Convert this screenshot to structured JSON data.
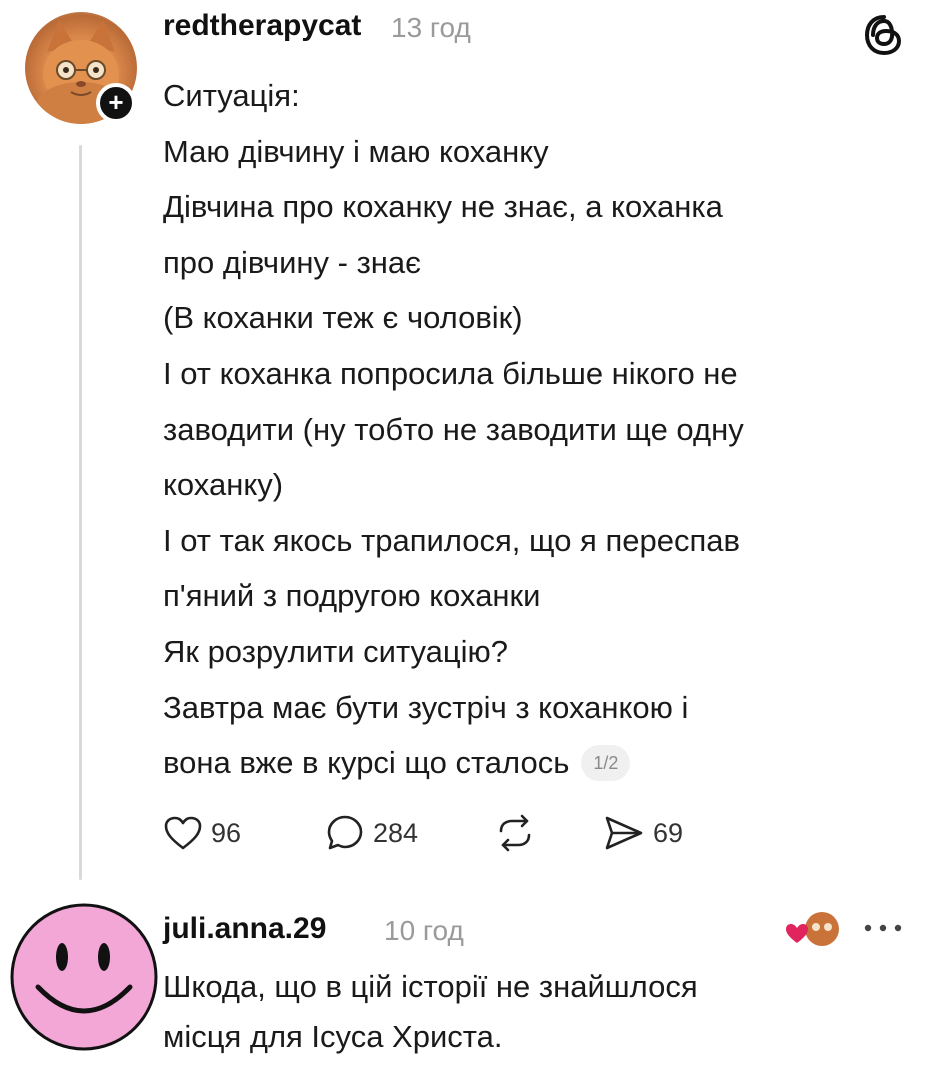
{
  "post": {
    "username": "redtherapycat",
    "time": "13 год",
    "lines": [
      "Ситуація:",
      "Маю дівчину і маю коханку",
      "Дівчина про коханку не знає, а коханка",
      "про дівчину - знає",
      "(В коханки теж є чоловік)",
      "І от коханка попросила більше нікого не",
      "заводити (ну тобто не заводити ще одну",
      "коханку)",
      "І от так якось трапилося, що я переспав",
      "п'яний з подругою коханки",
      "Як розрулити ситуацію?",
      "Завтра має бути зустріч з коханкою і",
      "вона вже в курсі що сталось"
    ],
    "page_indicator": "1/2",
    "likes": "96",
    "replies": "284",
    "shares": "69"
  },
  "reply": {
    "username": "juli.anna.29",
    "time": "10 год",
    "lines": [
      "Шкода, що в цій історії не знайшлося",
      "місця для Ісуса Христа."
    ]
  },
  "icons": {
    "like": "heart-icon",
    "reply": "comment-bubble-icon",
    "repost": "repost-icon",
    "share": "send-icon",
    "app": "threads-logo-icon",
    "more": "more-dots-icon",
    "liked_by_author": "liked-by-author-icon",
    "follow": "plus-icon"
  },
  "colors": {
    "text": "#1a1a1a",
    "secondary": "#9a9a9a",
    "heart_accent": "#e0245e",
    "smiley_fill": "#f2a7d6"
  }
}
